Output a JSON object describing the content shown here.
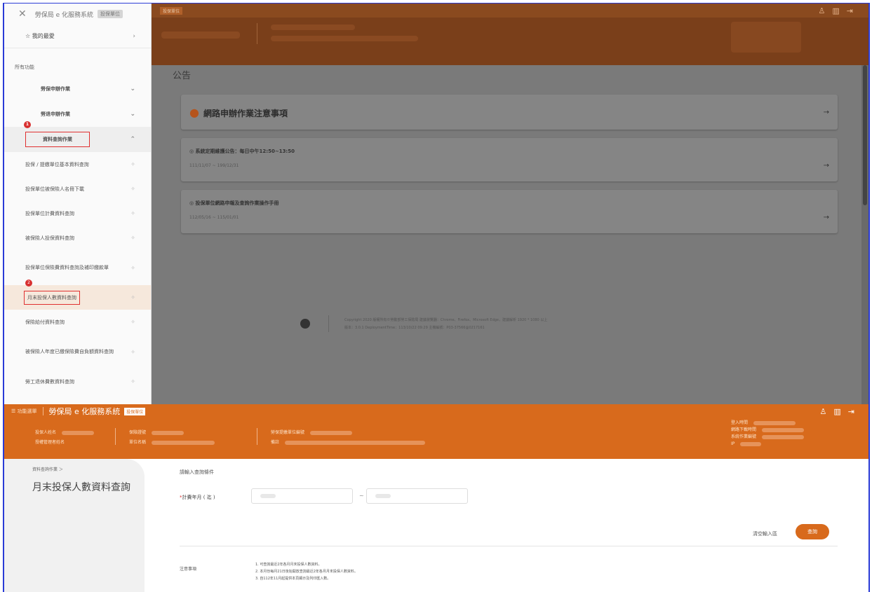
{
  "top": {
    "sidebar": {
      "app_title": "勞保局 e 化服務系統",
      "app_badge": "投保單位",
      "favorites_label": "我的最愛",
      "section_label": "所有功能",
      "groups": [
        {
          "label": "勞保申辦作業"
        },
        {
          "label": "勞退申辦作業"
        },
        {
          "label": "資料查詢作業"
        }
      ],
      "items": [
        {
          "label": "投保 / 提繳單位基本資料查詢"
        },
        {
          "label": "投保單位被保險人名冊下載"
        },
        {
          "label": "投保單位計費資料查詢"
        },
        {
          "label": "被保險人投保資料查詢"
        },
        {
          "label": "投保單位保險費資料查詢及補印繳款單"
        },
        {
          "label": "月末投保人數資料查詢"
        },
        {
          "label": "保險給付資料查詢"
        },
        {
          "label": "被保險人年度已繳保險費自負額資料查詢"
        },
        {
          "label": "勞工退休費數資料查詢"
        }
      ],
      "markers": [
        "1",
        "2"
      ]
    },
    "overlay": {
      "tag": "投保單位",
      "page_title": "公告",
      "headline": "網路申辦作業注意事項",
      "announcements": [
        {
          "title": "系統定期維護公告：每日中午12:50~13:50",
          "dates": "111/11/07 ~ 199/12/31"
        },
        {
          "title": "投保單位網路申報及查詢作業操作手冊",
          "dates": "112/05/16 ~ 115/01/01"
        }
      ],
      "footer_line1": "Copyright 2020 版權所有©勞動部勞工保險局 建議瀏覽器：Chrome、Firefox、Microsoft Edge，建議解析 1920 * 1080 以上",
      "footer_line2": "版本：3.0.1 DeploymentTime：113/10/22 09:29 主機編號：P03-37566@0217161"
    }
  },
  "bottom": {
    "menu_label": "功能選單",
    "system_name": "勞保局 e 化服務系統",
    "tag": "投保單位",
    "info": {
      "col1": [
        "投保人姓名",
        "授權管理者姓名"
      ],
      "col2": [
        "保險證號",
        "單位名稱"
      ],
      "col3": [
        "勞保提繳單位編號",
        "備註"
      ],
      "col4": [
        "登入時間",
        "網路下載時間",
        "系統作業編號",
        "IP"
      ]
    },
    "breadcrumb": "資料查詢作業 ＞",
    "page_title": "月末投保人數資料查詢",
    "query_title": "請輸入查詢條件",
    "field_label": "計費年月 ( 迄 )",
    "tilde": "~",
    "clear_label": "清空輸入區",
    "query_button": "查詢",
    "notes_label": "注意事項",
    "notes": [
      "1. 可查詢最近2年各月月末投保人數資料。",
      "2. 本月份每月21日後始開放查詢最近2年各月月末投保人數資料。",
      "3. 自112年11月起提供本頁顯示及列印匯入數。"
    ]
  }
}
